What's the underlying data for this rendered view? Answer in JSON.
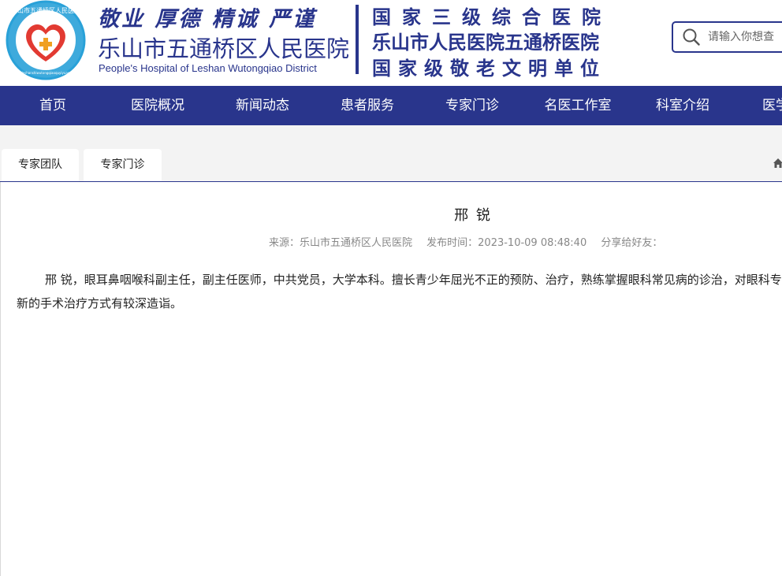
{
  "header": {
    "logo": {
      "ring_text": "乐山市五通桥区人民医院",
      "ring_text_small": "leshanshiwutongqiaoquyiyuan"
    },
    "motto": "敬业 厚德 精诚 严谨",
    "hospital_name_cn": "乐山市五通桥区人民医院",
    "hospital_name_en": "People's Hospital of Leshan Wutongqiao District",
    "titles": [
      "国家三级综合医院",
      "乐山市人民医院五通桥医院",
      "国家级敬老文明单位"
    ],
    "search_placeholder": "请输入你想查",
    "brand_color": "#29358c"
  },
  "nav": {
    "items": [
      "首页",
      "医院概况",
      "新闻动态",
      "患者服务",
      "专家门诊",
      "名医工作室",
      "科室介绍",
      "医学"
    ]
  },
  "tabs": [
    "专家团队",
    "专家门诊"
  ],
  "article": {
    "title": "邢 锐",
    "source_label": "来源：乐山市五通桥区人民医院",
    "time_label": "发布时间：2023-10-09 08:48:40",
    "share_label": "分享给好友："
  },
  "body": "邢 锐，眼耳鼻咽喉科副主任，副主任医师，中共党员，大学本科。擅长青少年屈光不正的预防、治疗，熟练掌握眼科常见病的诊治，对眼科专科新的手术治疗方式有较深造诣。"
}
